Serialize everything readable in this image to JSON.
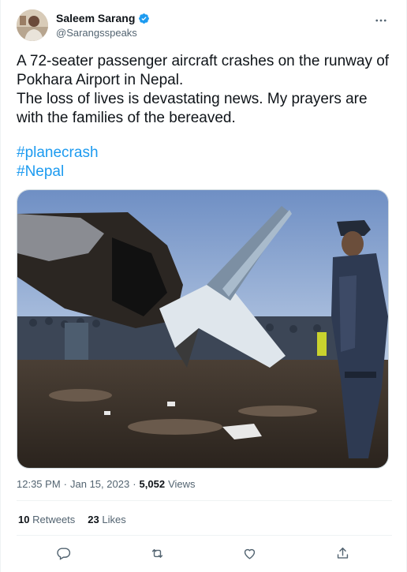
{
  "author": {
    "display_name": "Saleem Sarang",
    "handle": "@Sarangsspeaks",
    "verified": true
  },
  "tweet": {
    "line1": "A 72-seater passenger aircraft crashes on the runway of Pokhara Airport in Nepal.",
    "line2": "The loss of lives is devastating news. My prayers are with the families of the bereaved.",
    "hashtags": [
      "#planecrash",
      "#Nepal"
    ]
  },
  "meta": {
    "time": "12:35 PM",
    "separator": "·",
    "date": "Jan 15, 2023",
    "separator2": "·",
    "views_count": "5,052",
    "views_label": "Views"
  },
  "stats": {
    "retweets_count": "10",
    "retweets_label": "Retweets",
    "likes_count": "23",
    "likes_label": "Likes"
  },
  "icons": {
    "more": "more-horizontal-icon",
    "verified": "verified-badge-icon",
    "reply": "reply-icon",
    "retweet": "retweet-icon",
    "like": "heart-icon",
    "share": "share-icon"
  },
  "colors": {
    "accent": "#1d9bf0",
    "text": "#0f1419",
    "secondary": "#536471"
  }
}
